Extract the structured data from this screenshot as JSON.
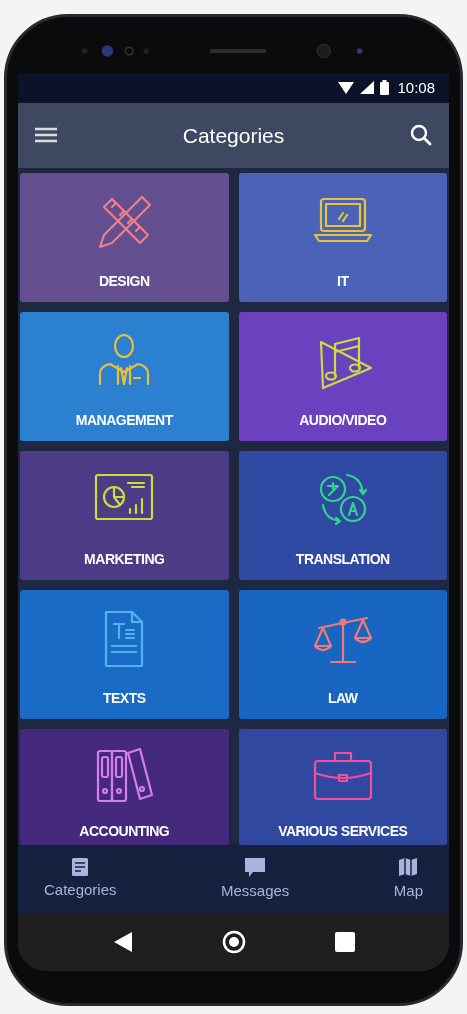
{
  "status_bar": {
    "time": "10:08"
  },
  "app_bar": {
    "title": "Categories"
  },
  "tiles": [
    {
      "label": "DESIGN",
      "kind": "design",
      "color": "#634e8f"
    },
    {
      "label": "IT",
      "kind": "it",
      "color": "#4a63b8"
    },
    {
      "label": "MANAGEMENT",
      "kind": "management",
      "color": "#2b80cf"
    },
    {
      "label": "AUDIO/VIDEO",
      "kind": "audio",
      "color": "#6a42c0"
    },
    {
      "label": "MARKETING",
      "kind": "marketing",
      "color": "#4c3c86"
    },
    {
      "label": "TRANSLATION",
      "kind": "translation",
      "color": "#3049a3"
    },
    {
      "label": "TEXTS",
      "kind": "texts",
      "color": "#1a6bc6"
    },
    {
      "label": "LAW",
      "kind": "law",
      "color": "#1866c2"
    },
    {
      "label": "ACCOUNTING",
      "kind": "accounting",
      "color": "#45297c"
    },
    {
      "label": "VARIOUS SERVICES",
      "kind": "services",
      "color": "#3048a0"
    }
  ],
  "bottom_nav": [
    {
      "label": "Categories",
      "kind": "list"
    },
    {
      "label": "Messages",
      "kind": "chat"
    },
    {
      "label": "Map",
      "kind": "map"
    }
  ]
}
